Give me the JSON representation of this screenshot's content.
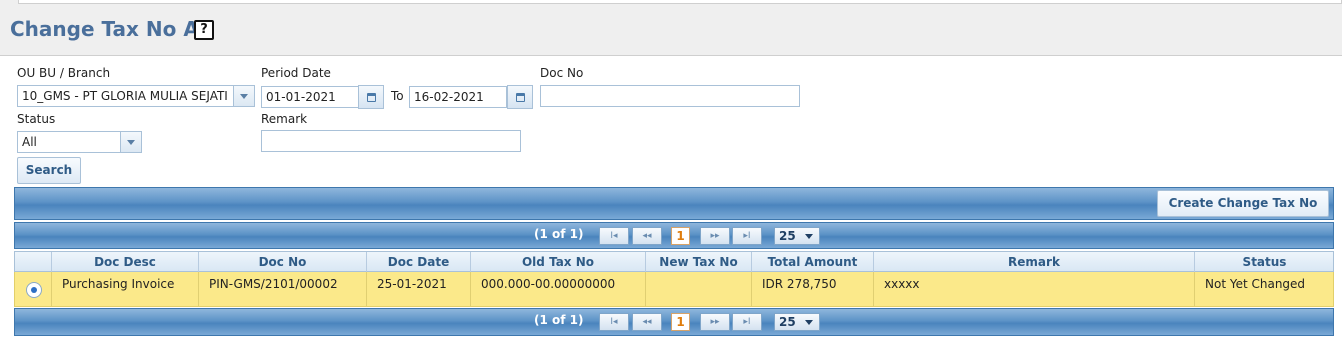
{
  "page": {
    "title": "Change Tax No AP",
    "help_icon": "?"
  },
  "filters": {
    "ou_label": "OU BU / Branch",
    "ou_value": "10_GMS - PT GLORIA MULIA SEJATI",
    "period_label": "Period Date",
    "period_from": "01-01-2021",
    "period_to_label": "To",
    "period_to": "16-02-2021",
    "docno_label": "Doc No",
    "docno_value": "",
    "status_label": "Status",
    "status_value": "All",
    "remark_label": "Remark",
    "remark_value": "",
    "search_label": "Search"
  },
  "toolbar": {
    "create_label": "Create Change Tax No AP"
  },
  "pager": {
    "info": "(1 of 1)",
    "first": "I◂",
    "prev": "◂◂",
    "current": "1",
    "next": "▸▸",
    "last": "▸I",
    "page_size": "25"
  },
  "table": {
    "headers": [
      "Doc Desc",
      "Doc No",
      "Doc Date",
      "Old Tax No",
      "New Tax No",
      "Total Amount",
      "Remark",
      "Status"
    ],
    "rows": [
      {
        "doc_desc": "Purchasing Invoice",
        "doc_no": "PIN-GMS/2101/00002",
        "doc_date": "25-01-2021",
        "old_tax_no": "000.000-00.00000000",
        "new_tax_no": "",
        "total_amount": "IDR 278,750",
        "remark": "xxxxx",
        "status": "Not Yet Changed",
        "selected": true
      }
    ]
  },
  "colors": {
    "title": "#4a6f9b",
    "bar": "#5d93c7",
    "selected_row": "#fbe98a",
    "page_current": "#e07d0c"
  }
}
